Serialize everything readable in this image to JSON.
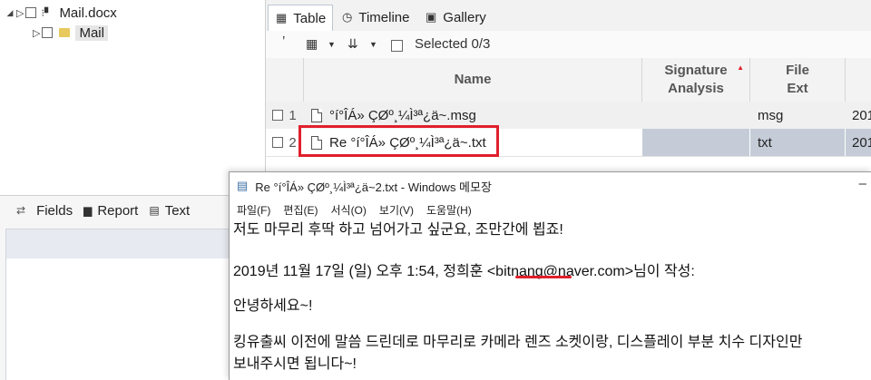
{
  "tree": {
    "root_label": "Mail.docx",
    "child_label": "Mail"
  },
  "bottom_left": {
    "tabs": [
      {
        "label": "Fields",
        "icon": "fields-icon"
      },
      {
        "label": "Report",
        "icon": "report-icon"
      },
      {
        "label": "Text",
        "icon": "text-icon"
      }
    ]
  },
  "view_tabs": [
    {
      "label": "Table",
      "icon": "table-icon",
      "active": true
    },
    {
      "label": "Timeline",
      "icon": "clock-icon",
      "active": false
    },
    {
      "label": "Gallery",
      "icon": "image-icon",
      "active": false
    }
  ],
  "toolbar": {
    "selected_text": "Selected 0/3"
  },
  "grid": {
    "columns": [
      "Name",
      "Signature Analysis",
      "File Ext"
    ],
    "rows": [
      {
        "index": "1",
        "name": "°í°ÎÁ» ÇØº¸¼Ì³ª¿ä~.msg",
        "ext": "msg",
        "next": "201"
      },
      {
        "index": "2",
        "name": "Re °í°ÎÁ» ÇØº¸¼Ì³ª¿ä~.txt",
        "ext": "txt",
        "next": "201"
      }
    ]
  },
  "notepad": {
    "title": "Re °í°ÎÁ» ÇØº¸¼Ì³ª¿ä~2.txt - Windows 메모장",
    "menu": [
      "파일(F)",
      "편집(E)",
      "서식(O)",
      "보기(V)",
      "도움말(H)"
    ],
    "lines": [
      "저도 마무리 후딱 하고 넘어가고 싶군요, 조만간에 뵙죠!",
      "2019년 11월 17일 (일) 오후 1:54, 정희훈 <bitnang@naver.com>님이 작성:",
      "안녕하세요~!",
      "킹유출씨 이전에 말씀 드린데로 마무리로 카메라 렌즈 소켓이랑, 디스플레이 부분 치수 디자인만",
      "보내주시면 됩니다~!"
    ]
  },
  "colors": {
    "highlight_red": "#e0202c",
    "selected_cell": "#c5ccd8"
  }
}
